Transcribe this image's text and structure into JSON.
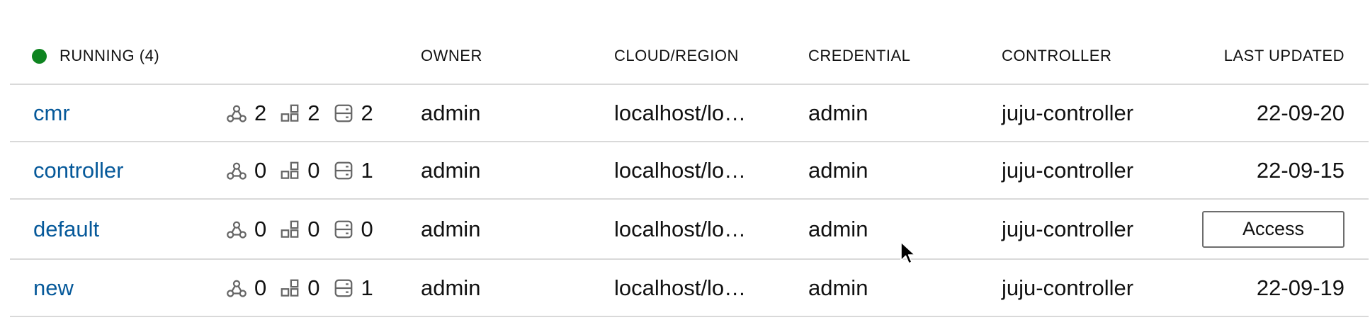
{
  "header": {
    "status_label": "RUNNING (4)",
    "owner": "OWNER",
    "cloud_region": "CLOUD/REGION",
    "credential": "CREDENTIAL",
    "controller": "CONTROLLER",
    "last_updated": "LAST UPDATED"
  },
  "colors": {
    "running": "#0e8420",
    "link": "#06599a",
    "divider": "#d9d9d9"
  },
  "icons": {
    "applications": "applications-icon",
    "units": "units-icon",
    "machines": "machines-icon"
  },
  "models": [
    {
      "name": "cmr",
      "applications": "2",
      "units": "2",
      "machines": "2",
      "owner": "admin",
      "cloud_region": "localhost/lo…",
      "credential": "admin",
      "controller": "juju-controller",
      "last_updated": "22-09-20"
    },
    {
      "name": "controller",
      "applications": "0",
      "units": "0",
      "machines": "1",
      "owner": "admin",
      "cloud_region": "localhost/lo…",
      "credential": "admin",
      "controller": "juju-controller",
      "last_updated": "22-09-15"
    },
    {
      "name": "default",
      "applications": "0",
      "units": "0",
      "machines": "0",
      "owner": "admin",
      "cloud_region": "localhost/lo…",
      "credential": "admin",
      "controller": "juju-controller",
      "access_label": "Access"
    },
    {
      "name": "new",
      "applications": "0",
      "units": "0",
      "machines": "1",
      "owner": "admin",
      "cloud_region": "localhost/lo…",
      "credential": "admin",
      "controller": "juju-controller",
      "last_updated": "22-09-19"
    }
  ]
}
